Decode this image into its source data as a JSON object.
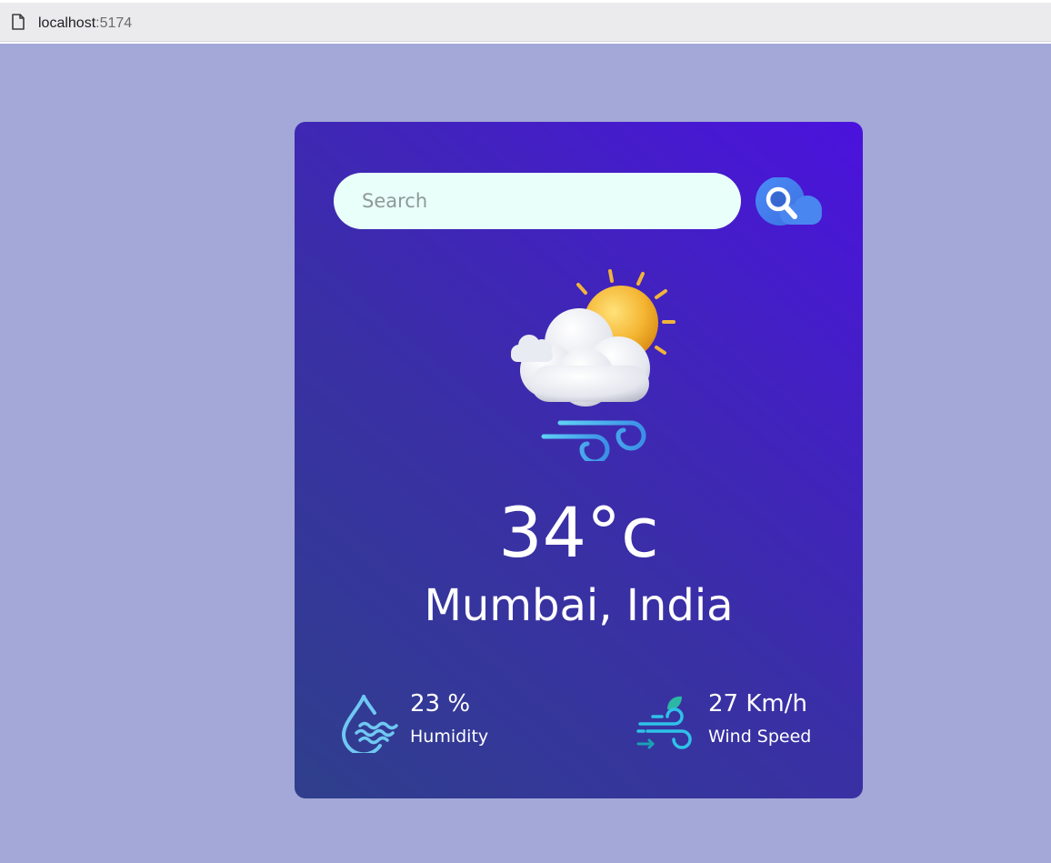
{
  "browser": {
    "url_host": "localhost",
    "url_port": ":5174"
  },
  "search": {
    "placeholder": "Search",
    "value": ""
  },
  "weather": {
    "icon": "partly-cloudy-windy-icon",
    "temperature": "34°c",
    "location": "Mumbai, India"
  },
  "humidity": {
    "value": "23 %",
    "label": "Humidity",
    "icon": "humidity-drop-icon"
  },
  "wind": {
    "value": "27 Km/h",
    "label": "Wind Speed",
    "icon": "wind-icon"
  },
  "colors": {
    "page_background": "#a3a8d8",
    "card_gradient_start": "#2f3f8c",
    "card_gradient_end": "#4b12dd",
    "search_background": "#e9fff9",
    "text": "#ffffff"
  }
}
